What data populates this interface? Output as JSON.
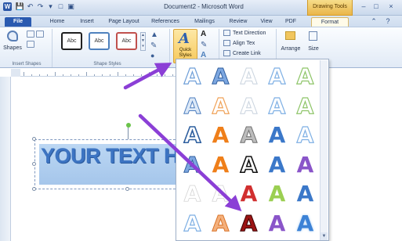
{
  "titlebar": {
    "title": "Document2 - Microsoft Word",
    "contextual_tab": "Drawing Tools",
    "app_icon_letter": "W",
    "save_icon": "save-icon",
    "undo_icon": "undo-icon",
    "redo_icon": "redo-icon",
    "minimize_icon": "minimize-icon",
    "maximize_icon": "maximize-icon",
    "close_icon": "close-icon"
  },
  "tabs": [
    "File",
    "Home",
    "Insert",
    "Page Layout",
    "References",
    "Mailings",
    "Review",
    "View",
    "PDF",
    "Format"
  ],
  "ribbon": {
    "groups": {
      "insert_shapes": "Insert Shapes",
      "shape_styles": "Shape Styles"
    },
    "shapes_label": "Shapes",
    "shape_style_samples": [
      "Abc",
      "Abc",
      "Abc"
    ],
    "shape_style_colors": [
      "#1f1f1f",
      "#4f81bd",
      "#c0504d"
    ],
    "quick_styles_label": "Quick Styles",
    "text_direction": "Text Direction",
    "align_text": "Align Tex",
    "create_link": "Create Link",
    "arrange": "Arrange",
    "size": "Size"
  },
  "document": {
    "textbox_text": "YOUR TEXT H"
  },
  "gallery": {
    "letter": "A",
    "rows": [
      [
        "outline-light-blue",
        "gradient-blue",
        "outline-faint",
        "outline-sky",
        "outline-green"
      ],
      [
        "outline-blue-fill",
        "outline-orange",
        "outline-faint",
        "outline-sky",
        "outline-green"
      ],
      [
        "outline-blue",
        "solid-orange",
        "metallic-grey",
        "solid-blue",
        "outline-sky"
      ],
      [
        "gradient-blue",
        "solid-orange",
        "black-outline",
        "solid-blue",
        "solid-purple"
      ],
      [
        "faint-white",
        "faint-white",
        "solid-red",
        "solid-green",
        "solid-blue"
      ],
      [
        "outline-sky",
        "gradient-orange",
        "dark-red",
        "solid-purple",
        "glow-blue"
      ]
    ]
  },
  "colors": {
    "accent_arrow": "#8b3fd6",
    "file_tab": "#2a5ab0",
    "contextual_tab": "#f2c55b",
    "textbox_fill": "#b6d2f1",
    "textbox_text": "#3d74c2"
  }
}
